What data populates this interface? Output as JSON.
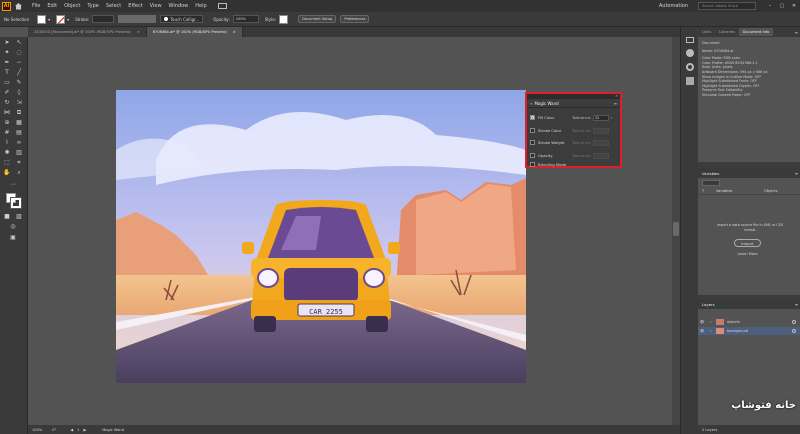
{
  "app": {
    "logo": "Ai",
    "home": "home-icon",
    "accent": "#ff9a00"
  },
  "menu": {
    "items": [
      "File",
      "Edit",
      "Object",
      "Type",
      "Select",
      "Effect",
      "View",
      "Window",
      "Help"
    ],
    "workspace": "Automation",
    "search_placeholder": "Search Adobe Stock"
  },
  "control": {
    "selection": "No Selection",
    "stroke_label": "Stroke:",
    "brush": "Touch Calligr...",
    "opacity_label": "Opacity:",
    "opacity_value": "100%",
    "style_label": "Style:",
    "doc_setup": "Document Setup",
    "preferences": "Preferences"
  },
  "tabs": [
    {
      "label": "2430453 [Recovered].ai* @ 100% (RGB/GPU Preview)"
    },
    {
      "label": "6706464.ai* @ 100% (RGB/GPU Preview)"
    }
  ],
  "magic_wand": {
    "title": "Magic Wand",
    "rows": [
      {
        "label": "Fill Color",
        "checked": true,
        "tol_label": "Tolerance:",
        "tol_value": "32"
      },
      {
        "label": "Stroke Color",
        "checked": false,
        "tol_label": "Tolerance:",
        "tol_value": ""
      },
      {
        "label": "Stroke Weight",
        "checked": false,
        "tol_label": "Tolerance:",
        "tol_value": ""
      },
      {
        "label": "Opacity",
        "checked": false,
        "tol_label": "Tolerance:",
        "tol_value": ""
      },
      {
        "label": "Blending Mode",
        "checked": false,
        "tol_label": "",
        "tol_value": ""
      }
    ],
    "highlight": "#e11d26"
  },
  "car": {
    "plate": "CAR 2255"
  },
  "doc_info": {
    "tabs": [
      "Links",
      "Libraries",
      "Document Info"
    ],
    "heading": "Document",
    "name": "Name: 6706464.ai",
    "lines": [
      "Color Mode: RGB color",
      "Color Profile: sRGB IEC61966-2.1",
      "Ruler Units: pixels",
      "Artboard Dimensions: 594 px x 568 px",
      "Show Images In Outline Mode: OFF",
      "Highlight Substituted Fonts: OFF",
      "Highlight Substituted Glyphs: OFF",
      "Preserve Text Editability",
      "Simulate Colored Paper: OFF"
    ]
  },
  "variables": {
    "title": "Variables",
    "col1": "Variables",
    "col2": "Objects",
    "import_text": "Import a data source file in XML or CSV format",
    "import_btn": "Import",
    "learn": "Learn More"
  },
  "layers": {
    "title": "Layers",
    "items": [
      "objects",
      "background"
    ],
    "footer": "2 Layers"
  },
  "status": {
    "zoom": "100%",
    "rotation": "0°",
    "page": "1",
    "tool": "Magic Wand"
  },
  "watermark": "خانه فتوشاپ"
}
